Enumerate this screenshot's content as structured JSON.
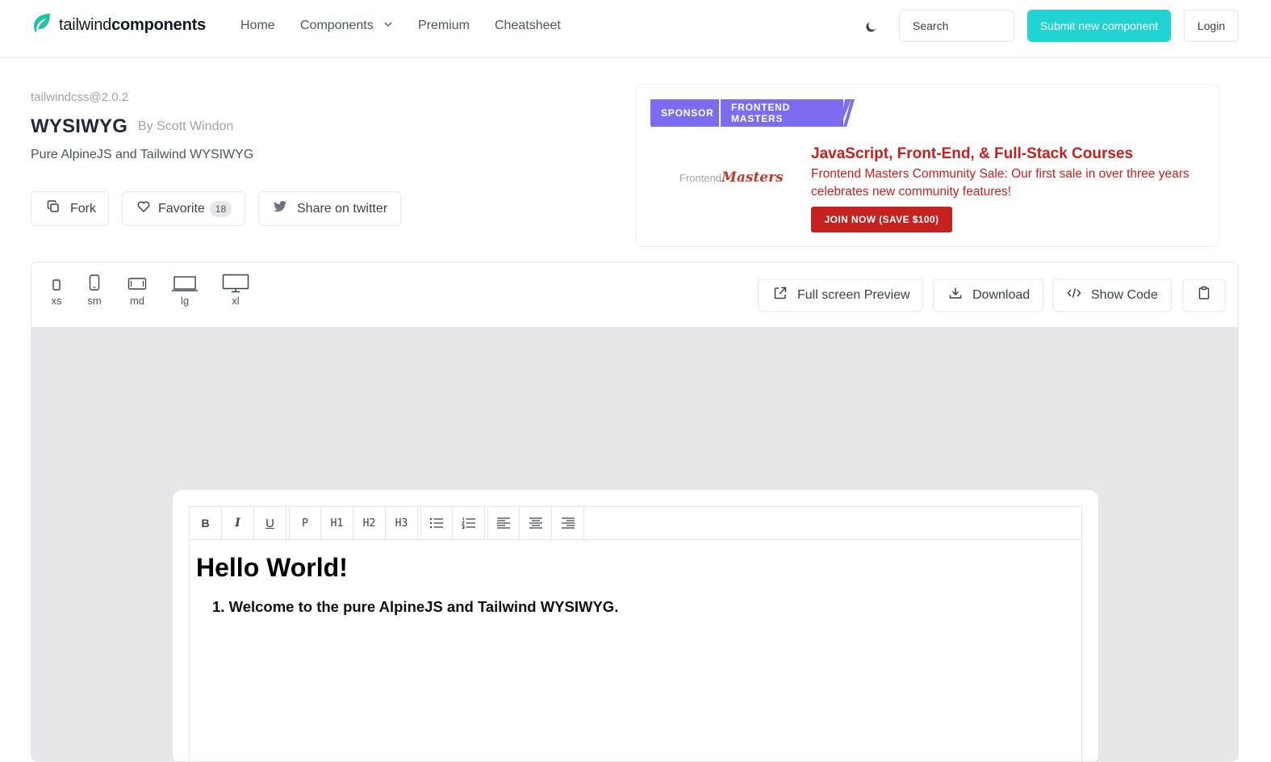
{
  "nav": {
    "brand_light": "tailwind",
    "brand_bold": "components",
    "links": [
      "Home",
      "Components",
      "Premium",
      "Cheatsheet"
    ],
    "search_placeholder": "Search",
    "submit_label": "Submit new component",
    "login_label": "Login"
  },
  "component": {
    "version": "tailwindcss@2.0.2",
    "title": "WYSIWYG",
    "author": "By Scott Windon",
    "description": "Pure AlpineJS and Tailwind WYSIWYG",
    "fork_label": "Fork",
    "favorite_label": "Favorite",
    "favorite_count": "18",
    "share_label": "Share on twitter"
  },
  "sponsor": {
    "tag": "SPONSOR",
    "name": "FRONTEND MASTERS",
    "logo_light": "Frontend",
    "logo_script": "Masters",
    "headline": "JavaScript, Front-End, & Full-Stack Courses",
    "body": "Frontend Masters Community Sale: Our first sale in over three years celebrates new community features!",
    "cta": "JOIN NOW (SAVE $100)",
    "accent": "#c5221f",
    "tag_color": "#7c6cf0"
  },
  "preview": {
    "devices": [
      "xs",
      "sm",
      "md",
      "lg",
      "xl"
    ],
    "fullscreen_label": "Full screen Preview",
    "download_label": "Download",
    "show_code_label": "Show Code"
  },
  "editor": {
    "toolbar": [
      "B",
      "I",
      "U",
      "P",
      "H1",
      "H2",
      "H3"
    ],
    "heading": "Hello World!",
    "list_item": "1. Welcome to the pure AlpineJS and Tailwind WYSIWYG."
  }
}
